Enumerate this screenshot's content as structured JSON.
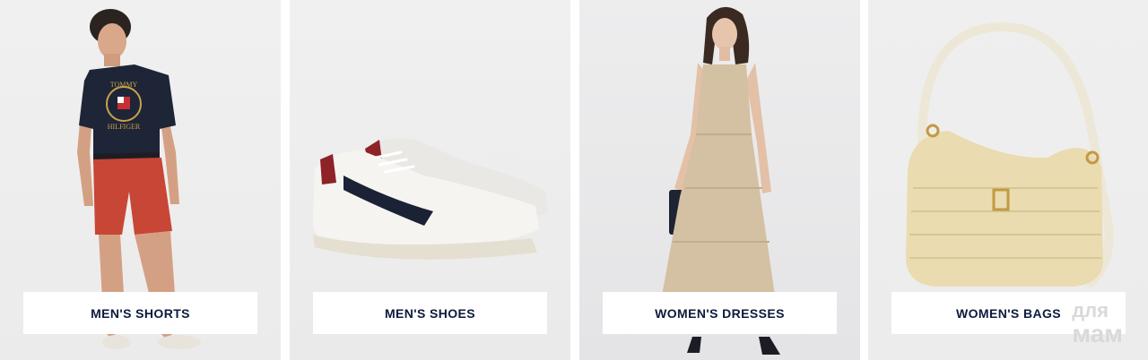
{
  "categories": [
    {
      "label": "MEN'S SHORTS",
      "image": "man-in-navy-tee-red-shorts"
    },
    {
      "label": "MEN'S SHOES",
      "image": "white-sneakers"
    },
    {
      "label": "WOMEN'S DRESSES",
      "image": "woman-in-beige-maxi-dress"
    },
    {
      "label": "WOMEN'S BAGS",
      "image": "woven-straw-shoulder-bag"
    }
  ],
  "tshirt_print": {
    "line1": "TOMMY",
    "line2": "HILFIGER"
  },
  "watermark": {
    "line1": "для",
    "line2": "мам"
  },
  "colors": {
    "cta_text": "#0c1b3c",
    "cta_bg": "#ffffff",
    "tile_bg": "#eeeeee"
  }
}
